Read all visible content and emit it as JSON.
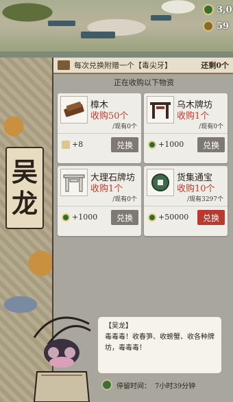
{
  "resources": [
    {
      "icon": "coin-icon",
      "value": "3,0"
    },
    {
      "icon": "copper-coin-icon",
      "value": "59"
    }
  ],
  "npc": {
    "name_chars": [
      "吴",
      "龙"
    ]
  },
  "banner": {
    "text": "每次兑换附赠一个【毒尖牙】",
    "remaining": "还剩0个"
  },
  "subtitle": "正在收购以下物资",
  "items": [
    {
      "title": "樟木",
      "request": "收购50个",
      "owned": "/现有0个",
      "reward": "+8",
      "reward_icon": "bone-icon",
      "button": "兑换",
      "button_color": "#7e7a73",
      "icon": "wood-log-icon"
    },
    {
      "title": "乌木牌坊",
      "request": "收购1个",
      "owned": "/现有0个",
      "reward": "+1000",
      "reward_icon": "coin-icon",
      "button": "兑换",
      "button_color": "#7e7a73",
      "icon": "archway-icon"
    },
    {
      "title": "大理石牌坊",
      "request": "收购1个",
      "owned": "/现有0个",
      "reward": "+1000",
      "reward_icon": "coin-icon",
      "button": "兑换",
      "button_color": "#7e7a73",
      "icon": "marble-archway-icon"
    },
    {
      "title": "货集通宝",
      "request": "收购10个",
      "owned": "/现有3297个",
      "reward": "+50000",
      "reward_icon": "coin-icon",
      "button": "兑换",
      "button_color": "#b73a2e",
      "icon": "copper-coin-icon"
    }
  ],
  "dialog": {
    "speaker": "【吴龙】",
    "text": "毒毒毒！收春笋、收螃蟹、收各种牌坊，毒毒毒！"
  },
  "timer": {
    "label": "停留时间：",
    "value": "7小时39分钟"
  },
  "colors": {
    "coin": "#2f6b3a",
    "coin_rim": "#e0cf72",
    "red": "#c23a2a",
    "panel": "#a8a69d"
  }
}
